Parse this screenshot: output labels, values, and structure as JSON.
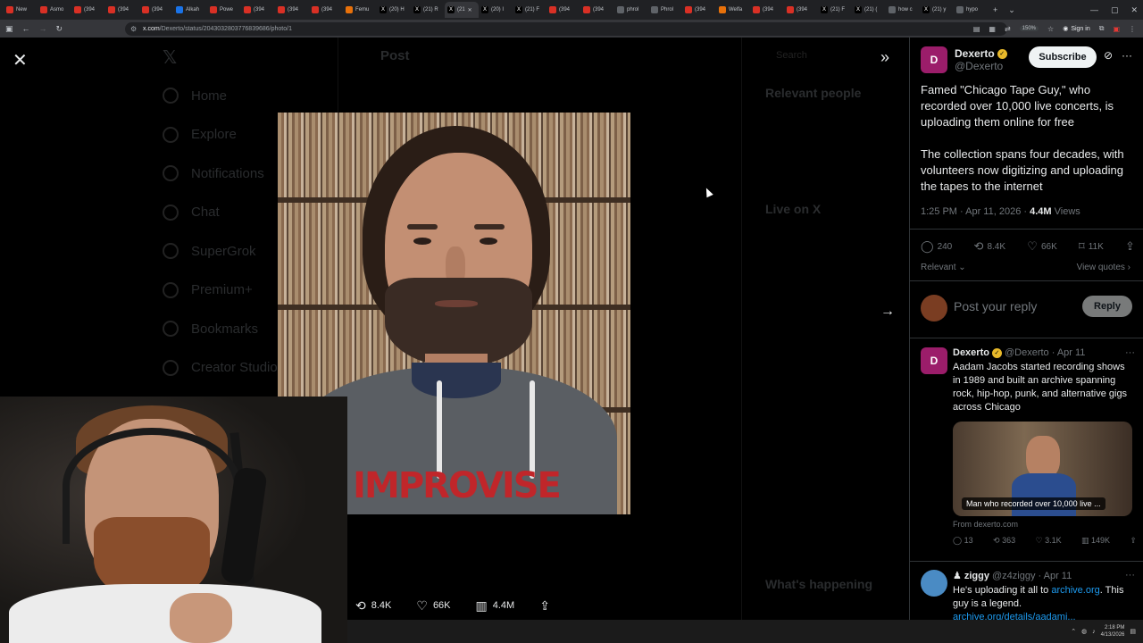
{
  "browser": {
    "tabs": [
      {
        "label": "New",
        "color": "#d93025",
        "glyph": ""
      },
      {
        "label": "Asmo",
        "color": "#d93025",
        "glyph": ""
      },
      {
        "label": "(394",
        "color": "#d93025",
        "glyph": ""
      },
      {
        "label": "(394",
        "color": "#d93025",
        "glyph": ""
      },
      {
        "label": "(394",
        "color": "#d93025",
        "glyph": ""
      },
      {
        "label": "Alkah",
        "color": "#1a73e8",
        "glyph": ""
      },
      {
        "label": "Powe",
        "color": "#d93025",
        "glyph": ""
      },
      {
        "label": "(394",
        "color": "#d93025",
        "glyph": ""
      },
      {
        "label": "(394",
        "color": "#d93025",
        "glyph": ""
      },
      {
        "label": "(394",
        "color": "#d93025",
        "glyph": ""
      },
      {
        "label": "Femu",
        "color": "#e8710a",
        "glyph": ""
      },
      {
        "label": "(20) H",
        "color": "#000000",
        "glyph": "X"
      },
      {
        "label": "(21) R",
        "color": "#000000",
        "glyph": "X"
      },
      {
        "label": "(21",
        "color": "#000000",
        "glyph": "X"
      },
      {
        "label": "(20) I",
        "color": "#000000",
        "glyph": "X"
      },
      {
        "label": "(21) F",
        "color": "#000000",
        "glyph": "X"
      },
      {
        "label": "(394",
        "color": "#d93025",
        "glyph": ""
      },
      {
        "label": "(394",
        "color": "#d93025",
        "glyph": ""
      },
      {
        "label": "phrol",
        "color": "#5f6368",
        "glyph": ""
      },
      {
        "label": "Phrol",
        "color": "#5f6368",
        "glyph": ""
      },
      {
        "label": "(394",
        "color": "#d93025",
        "glyph": ""
      },
      {
        "label": "Welfa",
        "color": "#e8710a",
        "glyph": ""
      },
      {
        "label": "(394",
        "color": "#d93025",
        "glyph": ""
      },
      {
        "label": "(394",
        "color": "#d93025",
        "glyph": ""
      },
      {
        "label": "(21) F",
        "color": "#000000",
        "glyph": "X"
      },
      {
        "label": "(21) (",
        "color": "#000000",
        "glyph": "X"
      },
      {
        "label": "how c",
        "color": "#5f6368",
        "glyph": ""
      },
      {
        "label": "(21) y",
        "color": "#000000",
        "glyph": "X"
      },
      {
        "label": "hypo",
        "color": "#5f6368",
        "glyph": ""
      }
    ],
    "active_tab_index": 13,
    "url_host": "x.com",
    "url_path": "/Dexerto/status/2043032803776839686/photo/1",
    "zoom": "150%",
    "sign_in": "Sign in"
  },
  "background_nav": [
    "Home",
    "Explore",
    "Notifications",
    "Chat",
    "SuperGrok",
    "Premium+",
    "Bookmarks",
    "Creator Studio"
  ],
  "background_page": {
    "post_title": "Post",
    "search": "Search",
    "relevant_people": "Relevant people",
    "live_on_x": "Live on X",
    "whats_happening": "What's happening"
  },
  "media": {
    "shirt_text": "IMPROVISE",
    "retweets": "8.4K",
    "likes": "66K",
    "views": "4.4M"
  },
  "post": {
    "author_name": "Dexerto",
    "author_handle": "@Dexerto",
    "avatar_letter": "D",
    "subscribe_label": "Subscribe",
    "text_p1": "Famed \"Chicago Tape Guy,\" who recorded over 10,000 live concerts, is uploading them online for free",
    "text_p2": "The collection spans four decades, with volunteers now digitizing and uploading the tapes to the internet",
    "timestamp": "1:25 PM · Apr 11, 2026 · ",
    "views_count": "4.4M",
    "views_label": " Views",
    "replies": "240",
    "retweets": "8.4K",
    "likes": "66K",
    "bookmarks": "11K",
    "sort_label": "Relevant",
    "view_quotes": "View quotes",
    "reply_placeholder": "Post your reply",
    "reply_button": "Reply"
  },
  "replies": [
    {
      "name": "Dexerto",
      "handle": "@Dexerto · Apr 11",
      "text": "Aadam Jacobs started recording shows in 1989 and built an archive spanning rock, hip-hop, punk, and alternative gigs across Chicago",
      "card_caption": "Man who recorded over 10,000 live ...",
      "card_source": "From dexerto.com",
      "replies": "13",
      "retweets": "363",
      "likes": "3.1K",
      "views": "149K"
    },
    {
      "name": "ziggy",
      "handle": "@z4ziggy · Apr 11",
      "text_before": "He's uploading it all to ",
      "link1": "archive.org",
      "text_after": ". This guy is a legend.",
      "link2": "archive.org/details/aadami..."
    }
  ],
  "taskbar": {
    "time": "2:18 PM",
    "date": "4/13/2026"
  },
  "colors": {
    "accent_blue": "#1d9bf0",
    "verified_gold": "#e8b92a",
    "dexerto_pink": "#9b1d6a"
  }
}
